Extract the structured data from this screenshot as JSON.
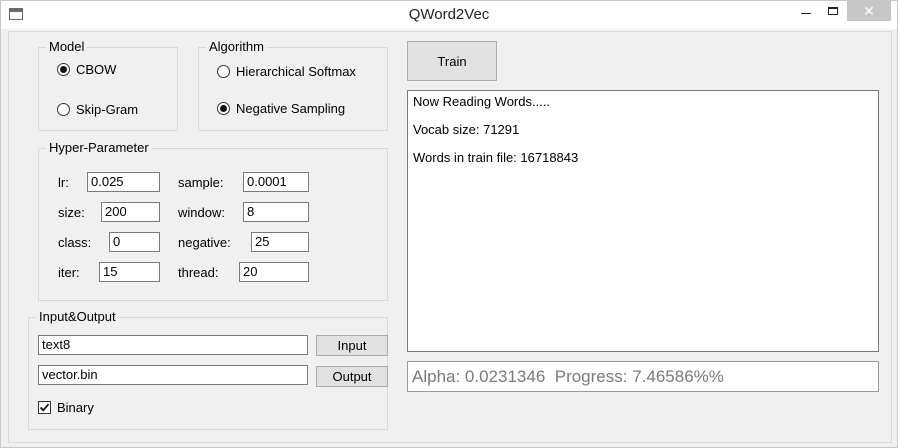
{
  "window": {
    "title": "QWord2Vec"
  },
  "model": {
    "legend": "Model",
    "options": [
      {
        "label": "CBOW",
        "selected": true
      },
      {
        "label": "Skip-Gram",
        "selected": false
      }
    ]
  },
  "algorithm": {
    "legend": "Algorithm",
    "options": [
      {
        "label": "Hierarchical Softmax",
        "selected": false
      },
      {
        "label": "Negative Sampling",
        "selected": true
      }
    ]
  },
  "hyper": {
    "legend": "Hyper-Parameter",
    "lr": {
      "label": "lr:",
      "value": "0.025"
    },
    "sample": {
      "label": "sample:",
      "value": "0.0001"
    },
    "size": {
      "label": "size:",
      "value": "200"
    },
    "window": {
      "label": "window:",
      "value": "8"
    },
    "class": {
      "label": "class:",
      "value": "0"
    },
    "negative": {
      "label": "negative:",
      "value": "25"
    },
    "iter": {
      "label": "iter:",
      "value": "15"
    },
    "thread": {
      "label": "thread:",
      "value": "20"
    }
  },
  "io": {
    "legend": "Input&Output",
    "input_value": "text8",
    "input_button": "Input",
    "output_value": "vector.bin",
    "output_button": "Output",
    "binary_label": "Binary",
    "binary_checked": true
  },
  "train_button": "Train",
  "log_lines": [
    "Now Reading Words.....",
    "Vocab size: 71291",
    "Words in train file: 16718843"
  ],
  "status_text": "Alpha: 0.0231346  Progress: 7.46586%%"
}
